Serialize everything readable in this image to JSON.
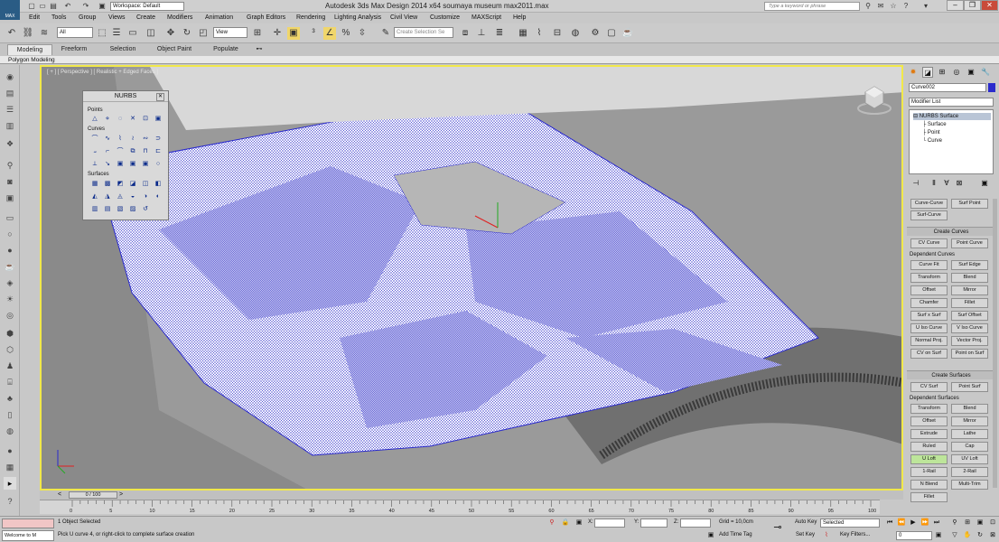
{
  "titlebar": {
    "ws_label": "Workspace: Default",
    "title": "Autodesk 3ds Max Design 2014 x64     soumaya museum max2011.max",
    "search_placeholder": "Type a keyword or phrase",
    "app_logo": "MAX"
  },
  "menu": [
    "Edit",
    "Tools",
    "Group",
    "Views",
    "Create",
    "Modifiers",
    "Animation",
    "Graph Editors",
    "Rendering",
    "Lighting Analysis",
    "Civil View",
    "Customize",
    "MAXScript",
    "Help"
  ],
  "toolbar": {
    "filter": "All",
    "ref_coord": "View",
    "sel_set_placeholder": "Create Selection Se"
  },
  "ribbon": {
    "tabs": [
      "Modeling",
      "Freeform",
      "Selection",
      "Object Paint",
      "Populate"
    ],
    "active": "Modeling",
    "sub": "Polygon Modeling"
  },
  "viewport": {
    "label": "[ + ] [ Perspective ] [ Realistic + Edged Faces ]",
    "active_border": "#f1e84a"
  },
  "nurbs": {
    "title": "NURBS",
    "groups": [
      "Points",
      "Curves",
      "Surfaces"
    ]
  },
  "cmd": {
    "object_name": "Curve002",
    "modifier_list": "Modifier List",
    "stack": [
      "NURBS Surface",
      "Surface",
      "Point",
      "Curve"
    ],
    "top_buttons": [
      "Curve-Curve",
      "Surf Point",
      "Surf-Curve"
    ],
    "create_curves_title": "Create Curves",
    "cv_curve": "CV Curve",
    "point_curve": "Point Curve",
    "dependent_curves": "Dependent Curves",
    "dep_curves": [
      "Curve Fit",
      "Surf Edge",
      "Transform",
      "Blend",
      "Offset",
      "Mirror",
      "Chamfer",
      "Fillet",
      "Surf x Surf",
      "Surf Offset",
      "U Iso Curve",
      "V Iso Curve",
      "Normal Proj.",
      "Vector Proj.",
      "CV on Surf",
      "Point on Surf"
    ],
    "create_surfaces_title": "Create Surfaces",
    "cv_surf": "CV Surf",
    "point_surf": "Point Surf",
    "dependent_surfaces": "Dependent Surfaces",
    "dep_surfaces": [
      "Transform",
      "Blend",
      "Offset",
      "Mirror",
      "Extrude",
      "Lathe",
      "Ruled",
      "Cap",
      "U Loft",
      "UV Loft",
      "1-Rail",
      "2-Rail",
      "N Blend",
      "Multi-Trim",
      "Fillet"
    ],
    "active_button": "U Loft"
  },
  "timeline": {
    "slider": "0 / 100",
    "ticks": [
      "0",
      "5",
      "10",
      "15",
      "20",
      "25",
      "30",
      "35",
      "40",
      "45",
      "50",
      "55",
      "60",
      "65",
      "70",
      "75",
      "80",
      "85",
      "90",
      "95",
      "100"
    ]
  },
  "status": {
    "listener": "Welcome to M",
    "selection": "1 Object Selected",
    "prompt": "Pick U curve 4, or right-click to complete surface creation",
    "x_label": "X:",
    "y_label": "Y:",
    "z_label": "Z:",
    "grid": "Grid = 10,0cm",
    "add_time_tag": "Add Time Tag",
    "auto_key": "Auto Key",
    "set_key": "Set Key",
    "selected": "Selected",
    "key_filters": "Key Filters...",
    "frame": "0"
  },
  "colors": {
    "wire": "#2b2bcc",
    "active_btn": "#bde59a",
    "viewport_bg": "#7f7f7f"
  }
}
